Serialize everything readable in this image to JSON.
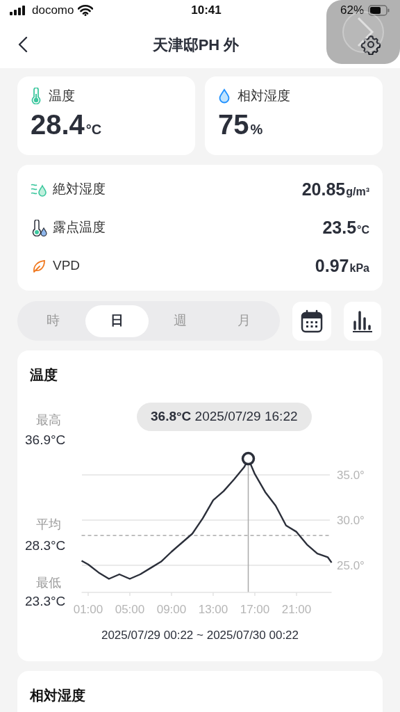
{
  "status_bar": {
    "carrier": "docomo",
    "time": "10:41",
    "battery": "62%"
  },
  "header": {
    "title": "天津邸PH 外"
  },
  "primary_cards": [
    {
      "kind": "temperature",
      "label": "温度",
      "value": "28.4",
      "unit": "°C"
    },
    {
      "kind": "humidity",
      "label": "相対湿度",
      "value": "75",
      "unit": "%"
    }
  ],
  "metrics": [
    {
      "kind": "absolute_humidity",
      "label": "絶対湿度",
      "value": "20.85",
      "unit": "g/m³"
    },
    {
      "kind": "dew_point",
      "label": "露点温度",
      "value": "23.5",
      "unit": "°C"
    },
    {
      "kind": "vpd",
      "label": "VPD",
      "value": "0.97",
      "unit": "kPa"
    }
  ],
  "period_tabs": [
    {
      "label": "時",
      "selected": false
    },
    {
      "label": "日",
      "selected": true
    },
    {
      "label": "週",
      "selected": false
    },
    {
      "label": "月",
      "selected": false
    }
  ],
  "chart_cards": [
    {
      "title": "温度",
      "stats": [
        {
          "label": "最高",
          "value": "36.9°C"
        },
        {
          "label": "平均",
          "value": "28.3°C"
        },
        {
          "label": "最低",
          "value": "23.3°C"
        }
      ],
      "tooltip": "**36.8°C** 2025/07/29 16:22",
      "chart_data": {
        "type": "line",
        "x": [
          0.37,
          1,
          2,
          3,
          4,
          5,
          6,
          7,
          8,
          9,
          10,
          11,
          12,
          13,
          14,
          15,
          16,
          16.37,
          17,
          18,
          19,
          20,
          21,
          22,
          23,
          24,
          24.37
        ],
        "series": [
          {
            "color": "#2b2f3a",
            "values": [
              25.5,
              25.1,
              24.2,
              23.5,
              24.0,
              23.5,
              24.0,
              24.7,
              25.4,
              26.5,
              27.5,
              28.5,
              30.2,
              32.2,
              33.2,
              34.5,
              35.9,
              36.8,
              35.1,
              33.1,
              31.6,
              29.4,
              28.7,
              27.3,
              26.3,
              25.9,
              25.3
            ]
          }
        ],
        "xlim": [
          0.37,
          24.37
        ],
        "ylim": [
          22,
          37.5
        ],
        "grid": true,
        "xticks": [
          {
            "value": 1,
            "label": "01:00"
          },
          {
            "value": 5,
            "label": "05:00"
          },
          {
            "value": 9,
            "label": "09:00"
          },
          {
            "value": 13,
            "label": "13:00"
          },
          {
            "value": 17,
            "label": "17:00"
          },
          {
            "value": 21,
            "label": "21:00"
          }
        ],
        "yticks": [
          {
            "value": 35,
            "label": "35.0°"
          },
          {
            "value": 30,
            "label": "30.0°"
          },
          {
            "value": 25,
            "label": "25.0°"
          }
        ],
        "ref_lines": [
          {
            "axis": "y",
            "value": 28.3
          },
          {
            "axis": "x",
            "value": 16.37
          }
        ]
      },
      "range": "2025/07/29 00:22 ~ 2025/07/30 00:22"
    },
    {
      "title": "相対湿度"
    }
  ]
}
